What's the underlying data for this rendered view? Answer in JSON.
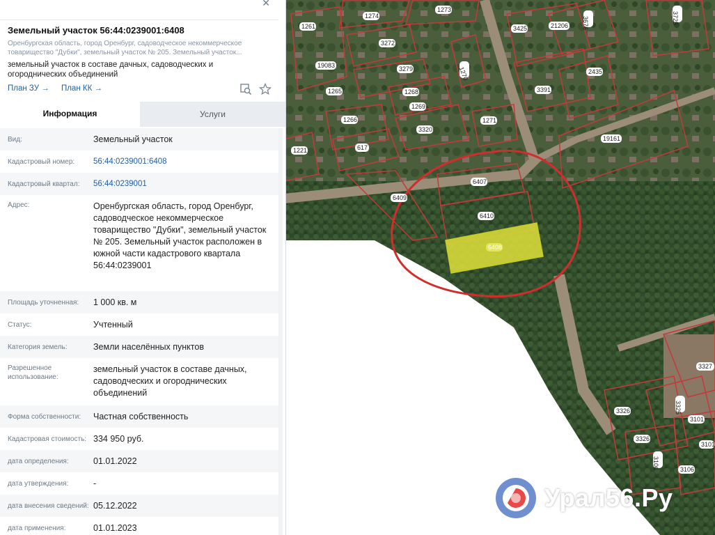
{
  "panel": {
    "title": "Земельный участок 56:44:0239001:6408",
    "address_short": "Оренбургская область, город Оренбург, садоводческое некоммерческое товарищество \"Дубки\", земельный участок № 205. Земельный участок...",
    "purpose": "земельный участок в составе дачных, садоводческих и огороднических объединений",
    "plan_zu": "План ЗУ →",
    "plan_kk": "План КК →",
    "tabs": [
      "Информация",
      "Услуги"
    ],
    "rows": [
      {
        "label": "Вид:",
        "value": "Земельный участок"
      },
      {
        "label": "Кадастровый номер:",
        "value": "56:44:0239001:6408"
      },
      {
        "label": "Кадастровый квартал:",
        "value": "56:44:0239001"
      },
      {
        "label": "Адрес:",
        "value": "Оренбургская область, город Оренбург, садоводческое некоммерческое товарищество \"Дубки\", земельный участок № 205. Земельный участок расположен в южной части кадастрового квартала 56:44:0239001"
      },
      {
        "label": "Площадь уточненная:",
        "value": "1 000 кв. м"
      },
      {
        "label": "Статус:",
        "value": "Учтенный"
      },
      {
        "label": "Категория земель:",
        "value": "Земли населённых пунктов"
      },
      {
        "label": "Разрешенное использование:",
        "value": "земельный участок в составе дачных, садоводческих и огороднических объединений"
      },
      {
        "label": "Форма собственности:",
        "value": "Частная собственность"
      },
      {
        "label": "Кадастровая стоимость:",
        "value": "334 950 руб."
      },
      {
        "label": "дата определения:",
        "value": "01.01.2022"
      },
      {
        "label": "дата утверждения:",
        "value": "-"
      },
      {
        "label": "дата внесения сведений:",
        "value": "05.12.2022"
      },
      {
        "label": "дата применения:",
        "value": "01.01.2023"
      }
    ]
  },
  "map": {
    "parcel_labels": [
      "1274",
      "1273",
      "3425",
      "21206",
      "3676",
      "3725",
      "1261",
      "3272",
      "19083",
      "3279",
      "1270",
      "2435",
      "1265",
      "1268",
      "3391",
      "1269",
      "1271",
      "1266",
      "3320",
      "19161",
      "1221",
      "617",
      "6407",
      "6409",
      "6410",
      "6408",
      "3327",
      "3326",
      "3325",
      "3101",
      "3326",
      "3106",
      "3106",
      "3101"
    ],
    "selected_parcel": "6408",
    "highlight_color": "#e6e63a",
    "boundary_color": "#c8313a"
  },
  "watermark": {
    "text": "Урал56.Ру"
  }
}
